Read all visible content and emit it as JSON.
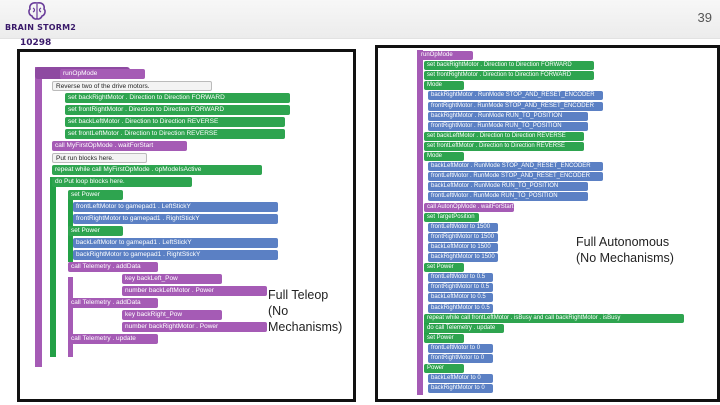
{
  "header": {
    "brand": "BRAIN STORM2",
    "team_number": "10298",
    "page_number": "39"
  },
  "teleop": {
    "caption": "Full Teleop\n(No\nMechanisms)",
    "blocks": [
      "runOpMode",
      "Reverse two of the drive motors.",
      "set backRightMotor . Direction to Direction FORWARD",
      "set frontRightMotor . Direction to Direction FORWARD",
      "set backLeftMotor . Direction to Direction REVERSE",
      "set frontLeftMotor . Direction to Direction REVERSE",
      "call MyFirstOpMode . waitForStart",
      "Put run blocks here.",
      "repeat while call MyFirstOpMode . opModeIsActive",
      "do Put loop blocks here.",
      "set Power",
      "frontLeftMotor to gamepad1 . LeftStickY",
      "frontRightMotor to gamepad1 . RightStickY",
      "set Power",
      "backLeftMotor to gamepad1 . LeftStickY",
      "backRightMotor to gamepad1 . RightStickY",
      "call Telemetry . addData",
      "key backLeft_Pow",
      "number backLeftMotor . Power",
      "call Telemetry . addData",
      "key backRight_Pow",
      "number backRightMotor . Power",
      "call Telemetry . update"
    ]
  },
  "auto": {
    "caption": "Full Autonomous\n(No Mechanisms)",
    "blocks": [
      "runOpMode",
      "set backRightMotor . Direction to Direction FORWARD",
      "set frontRightMotor . Direction to Direction FORWARD",
      "Mode",
      "backRightMotor . RunMode STOP_AND_RESET_ENCODER",
      "frontRightMotor . RunMode STOP_AND_RESET_ENCODER",
      "backRightMotor . RunMode RUN_TO_POSITION",
      "frontRightMotor . RunMode RUN_TO_POSITION",
      "set backLeftMotor . Direction to Direction REVERSE",
      "set frontLeftMotor . Direction to Direction REVERSE",
      "Mode",
      "backLeftMotor . RunMode STOP_AND_RESET_ENCODER",
      "frontLeftMotor . RunMode STOP_AND_RESET_ENCODER",
      "backLeftMotor . RunMode RUN_TO_POSITION",
      "frontLeftMotor . RunMode RUN_TO_POSITION",
      "call AutonOpMode . waitForStart",
      "set TargetPosition",
      "frontLeftMotor to 1500",
      "frontRightMotor to 1500",
      "backLeftMotor to 1500",
      "backRightMotor to 1500",
      "set Power",
      "frontLeftMotor to 0.5",
      "frontRightMotor to 0.5",
      "backLeftMotor to 0.5",
      "backRightMotor to 0.5",
      "repeat while call frontLeftMotor . isBusy and call backRightMotor . isBusy",
      "do call Telemetry . update",
      "set Power",
      "frontLeftMotor to 0",
      "frontRightMotor to 0",
      "Power",
      "backLeftMotor to 0",
      "backRightMotor to 0"
    ]
  }
}
